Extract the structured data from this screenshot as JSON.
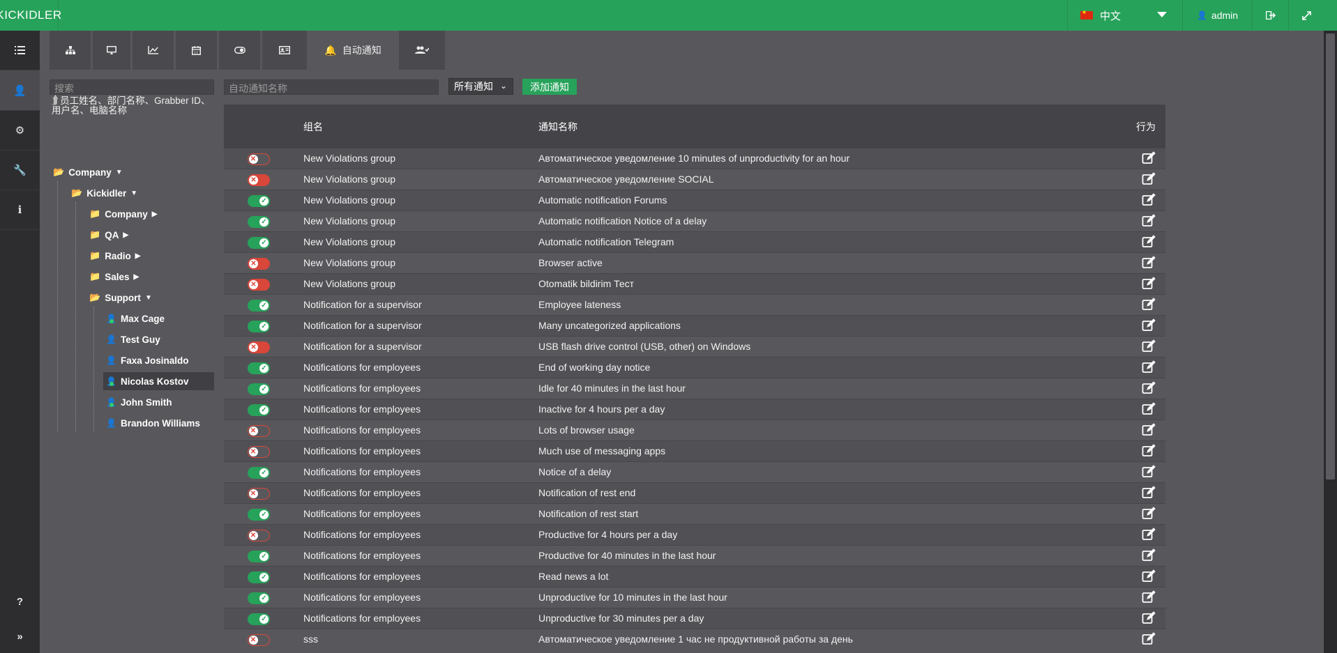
{
  "header": {
    "logo": "KICKIDLER",
    "language": "中文",
    "user": "admin"
  },
  "tabs": {
    "active_label": "自动通知"
  },
  "search": {
    "placeholder": "搜索",
    "hint": "员工姓名、部门名称、Grabber ID、用户名、电脑名称"
  },
  "tree": {
    "root": "Company",
    "org": "Kickidler",
    "depts": [
      "Company",
      "QA",
      "Radio",
      "Sales",
      "Support"
    ],
    "users": [
      "Max Cage",
      "Test Guy",
      "Faxa Josinaldo",
      "Nicolas Kostov",
      "John Smith",
      "Brandon Williams"
    ]
  },
  "toolbar": {
    "name_placeholder": "自动通知名称",
    "filter_value": "所有通知",
    "add_label": "添加通知"
  },
  "table": {
    "col_group": "组名",
    "col_name": "通知名称",
    "col_action": "行为",
    "rows": [
      {
        "status": "offline",
        "group": "New Violations group",
        "name": "Автоматическое уведомление 10 minutes of unproductivity for an hour"
      },
      {
        "status": "off",
        "group": "New Violations group",
        "name": "Автоматическое уведомление SOCIAL"
      },
      {
        "status": "on",
        "group": "New Violations group",
        "name": "Automatic notification Forums"
      },
      {
        "status": "on",
        "group": "New Violations group",
        "name": "Automatic notification Notice of a delay"
      },
      {
        "status": "on",
        "group": "New Violations group",
        "name": "Automatic notification Telegram"
      },
      {
        "status": "off",
        "group": "New Violations group",
        "name": "Browser active"
      },
      {
        "status": "off",
        "group": "New Violations group",
        "name": "Otomatik bildirim Тест"
      },
      {
        "status": "on",
        "group": "Notification for a supervisor",
        "name": "Employee lateness"
      },
      {
        "status": "on",
        "group": "Notification for a supervisor",
        "name": "Many uncategorized applications"
      },
      {
        "status": "off",
        "group": "Notification for a supervisor",
        "name": "USB flash drive control (USB, other) on Windows"
      },
      {
        "status": "on",
        "group": "Notifications for employees",
        "name": "End of working day notice"
      },
      {
        "status": "on",
        "group": "Notifications for employees",
        "name": "Idle for 40 minutes in the last hour"
      },
      {
        "status": "on",
        "group": "Notifications for employees",
        "name": "Inactive for 4 hours per a day"
      },
      {
        "status": "offline",
        "group": "Notifications for employees",
        "name": "Lots of browser usage"
      },
      {
        "status": "offline",
        "group": "Notifications for employees",
        "name": "Much use of messaging apps"
      },
      {
        "status": "on",
        "group": "Notifications for employees",
        "name": "Notice of a delay"
      },
      {
        "status": "offline",
        "group": "Notifications for employees",
        "name": "Notification of rest end"
      },
      {
        "status": "on",
        "group": "Notifications for employees",
        "name": "Notification of rest start"
      },
      {
        "status": "offline",
        "group": "Notifications for employees",
        "name": "Productive for 4 hours per a day"
      },
      {
        "status": "on",
        "group": "Notifications for employees",
        "name": "Productive for 40 minutes in the last hour"
      },
      {
        "status": "on",
        "group": "Notifications for employees",
        "name": "Read news a lot"
      },
      {
        "status": "on",
        "group": "Notifications for employees",
        "name": "Unproductive for 10 minutes in the last hour"
      },
      {
        "status": "on",
        "group": "Notifications for employees",
        "name": "Unproductive for 30 minutes per a day"
      },
      {
        "status": "offline",
        "group": "sss",
        "name": "Автоматическое уведомление 1 час не продуктивной работы за день"
      }
    ]
  }
}
